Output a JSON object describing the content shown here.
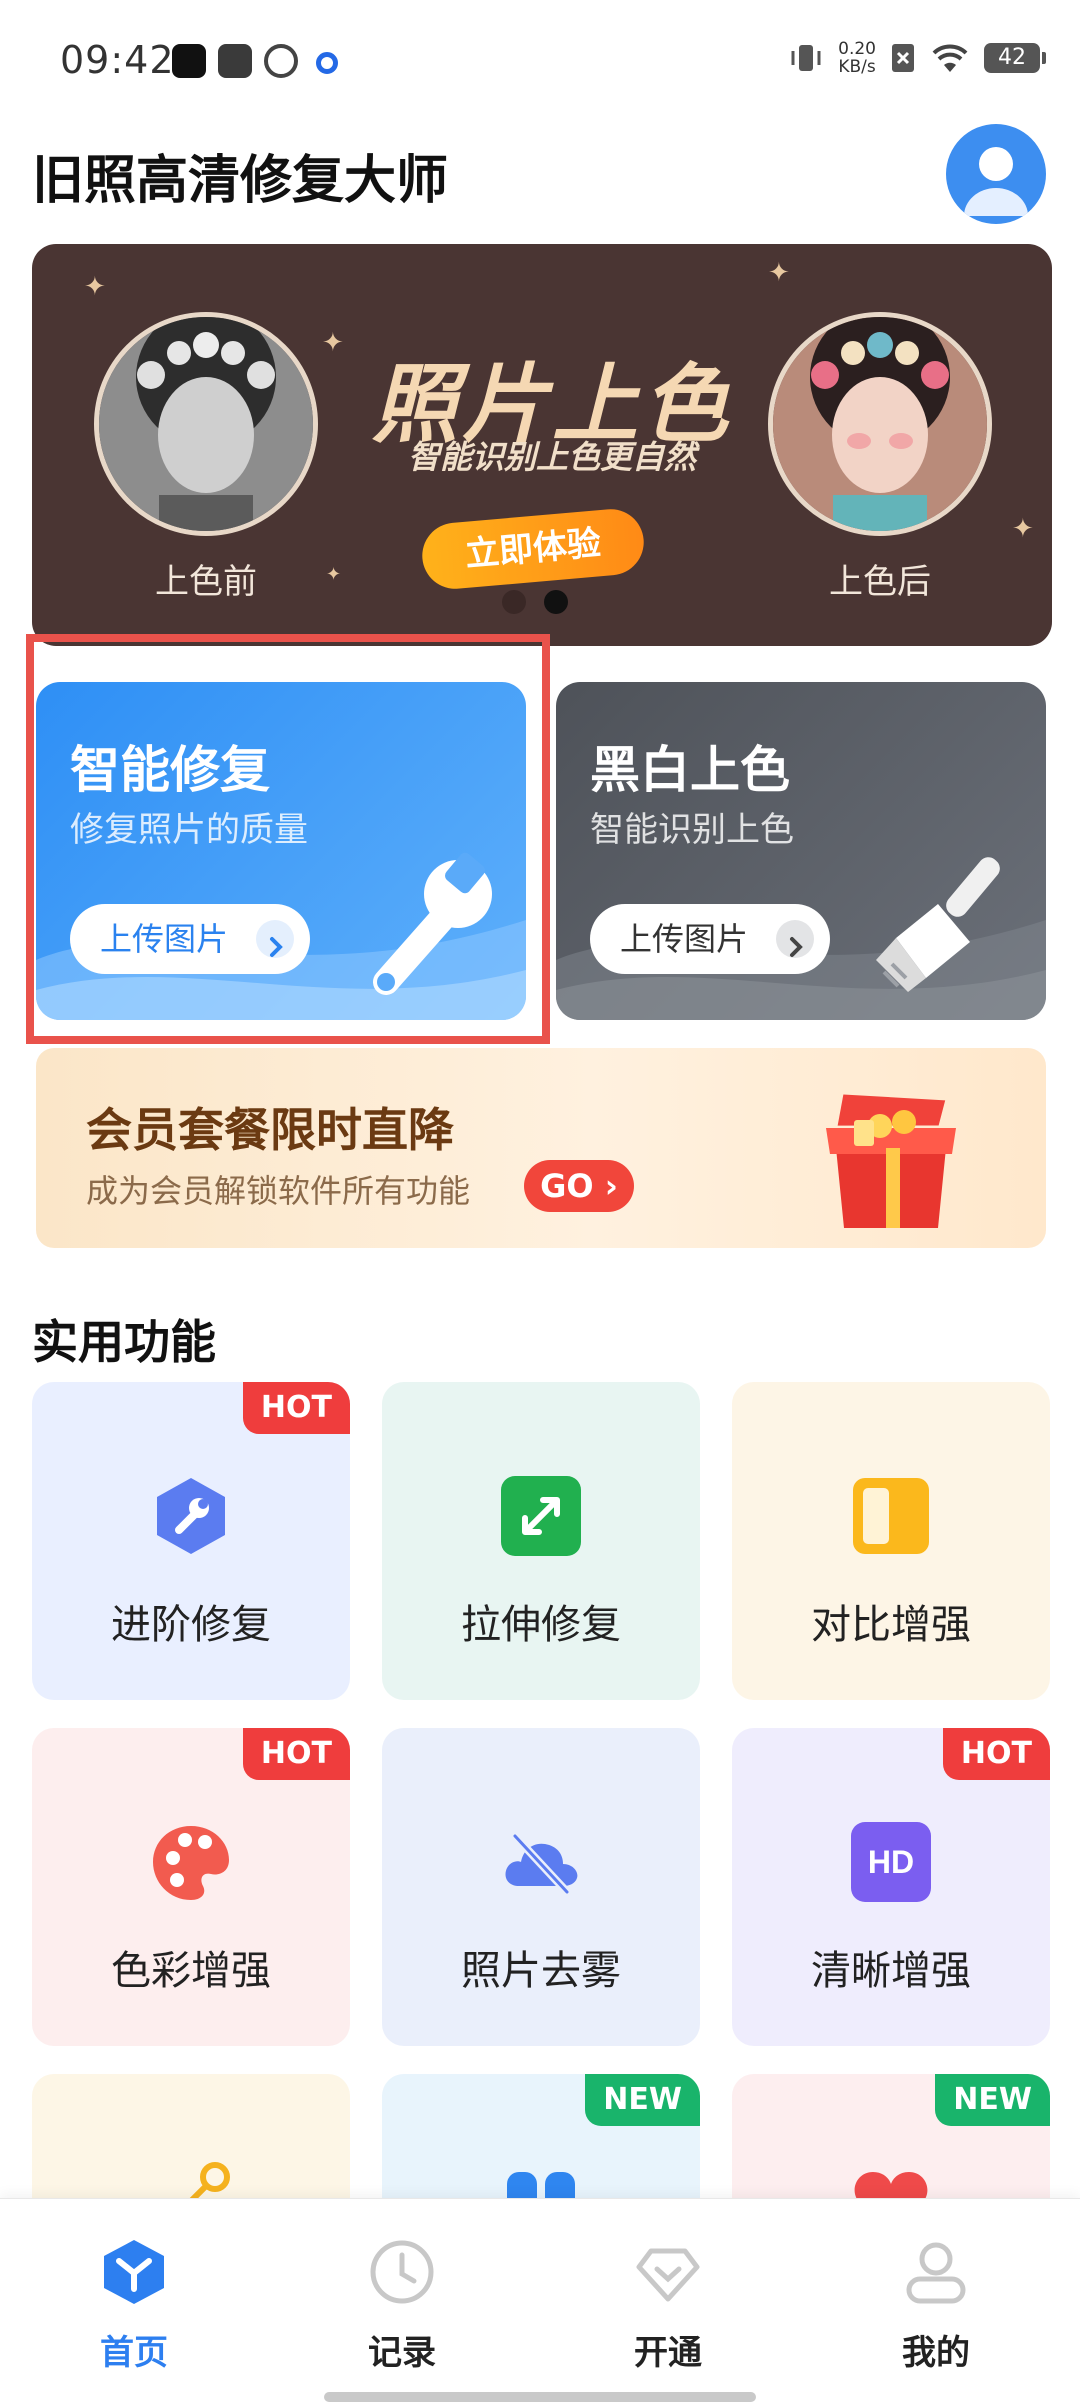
{
  "status_bar": {
    "time": "09:42",
    "net_speed_value": "0.20",
    "net_speed_unit": "KB/s",
    "battery": "42",
    "icons": [
      "tiktok-icon",
      "mail-icon",
      "sync-icon",
      "browser-icon",
      "vibrate-icon",
      "sim-off-icon",
      "wifi-icon",
      "battery-icon"
    ]
  },
  "header": {
    "title": "旧照高清修复大师",
    "avatar_icon": "user-avatar-icon"
  },
  "banner": {
    "headline": "照片上色",
    "subtitle": "智能识别上色更自然",
    "cta": "立即体验",
    "before_label": "上色前",
    "after_label": "上色后",
    "slides": 2,
    "active_slide": 2
  },
  "feature_cards": [
    {
      "title": "智能修复",
      "subtitle": "修复照片的质量",
      "button": "上传图片",
      "icon": "wrench-icon"
    },
    {
      "title": "黑白上色",
      "subtitle": "智能识别上色",
      "button": "上传图片",
      "icon": "paint-brush-icon"
    }
  ],
  "vip": {
    "title": "会员套餐限时直降",
    "subtitle": "成为会员解锁软件所有功能",
    "go": "GO"
  },
  "section": {
    "title": "实用功能",
    "tiles": [
      {
        "label": "进阶修复",
        "tag": "HOT",
        "icon": "hex-wrench-icon"
      },
      {
        "label": "拉伸修复",
        "tag": "",
        "icon": "expand-icon"
      },
      {
        "label": "对比增强",
        "tag": "",
        "icon": "contrast-icon"
      },
      {
        "label": "色彩增强",
        "tag": "HOT",
        "icon": "palette-icon"
      },
      {
        "label": "照片去雾",
        "tag": "",
        "icon": "cloud-off-icon"
      },
      {
        "label": "清晰增强",
        "tag": "HOT",
        "icon": "hd-icon"
      },
      {
        "label": "",
        "tag": "",
        "icon": "key-icon"
      },
      {
        "label": "",
        "tag": "NEW",
        "icon": "quote-icon"
      },
      {
        "label": "",
        "tag": "NEW",
        "icon": "heart-icon"
      }
    ]
  },
  "nav": {
    "items": [
      {
        "label": "首页",
        "icon": "home-icon",
        "active": true
      },
      {
        "label": "记录",
        "icon": "clock-icon",
        "active": false
      },
      {
        "label": "开通",
        "icon": "diamond-icon",
        "active": false
      },
      {
        "label": "我的",
        "icon": "profile-icon",
        "active": false
      }
    ]
  },
  "colors": {
    "accent": "#2d7ff0",
    "banner_bg": "#4a3533",
    "hot_tag": "#ef3d3d",
    "new_tag": "#19b46b",
    "highlight": "#e9524b"
  }
}
